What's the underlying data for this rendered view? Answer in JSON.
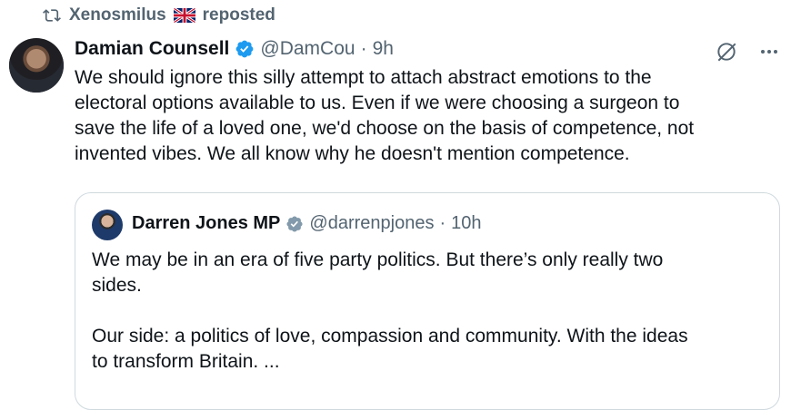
{
  "repost": {
    "user": "Xenosmilus",
    "label": "reposted",
    "repost_icon": "repost-icon",
    "flag_icon": "uk-flag-icon"
  },
  "post": {
    "display_name": "Damian Counsell",
    "handle": "@DamCou",
    "separator": "·",
    "time": "9h",
    "text": "We should ignore this silly attempt to attach abstract emotions to the\nelectoral options available to us. Even if we were choosing a surgeon to\nsave the life of a loved one, we'd choose on the basis of competence, not\ninvented vibes. We all know why he doesn't mention competence."
  },
  "quote": {
    "display_name": "Darren Jones MP",
    "handle": "@darrenpjones",
    "separator": "·",
    "time": "10h",
    "text": "We may be in an era of five party politics. But there’s only really two\nsides.\n\nOur side: a politics of love, compassion and community. With the ideas\nto transform Britain. ..."
  },
  "colors": {
    "verified_blue": "#1d9bf0",
    "verified_grey": "#829aab",
    "muted_text": "#536471",
    "border": "#cfd9de"
  }
}
